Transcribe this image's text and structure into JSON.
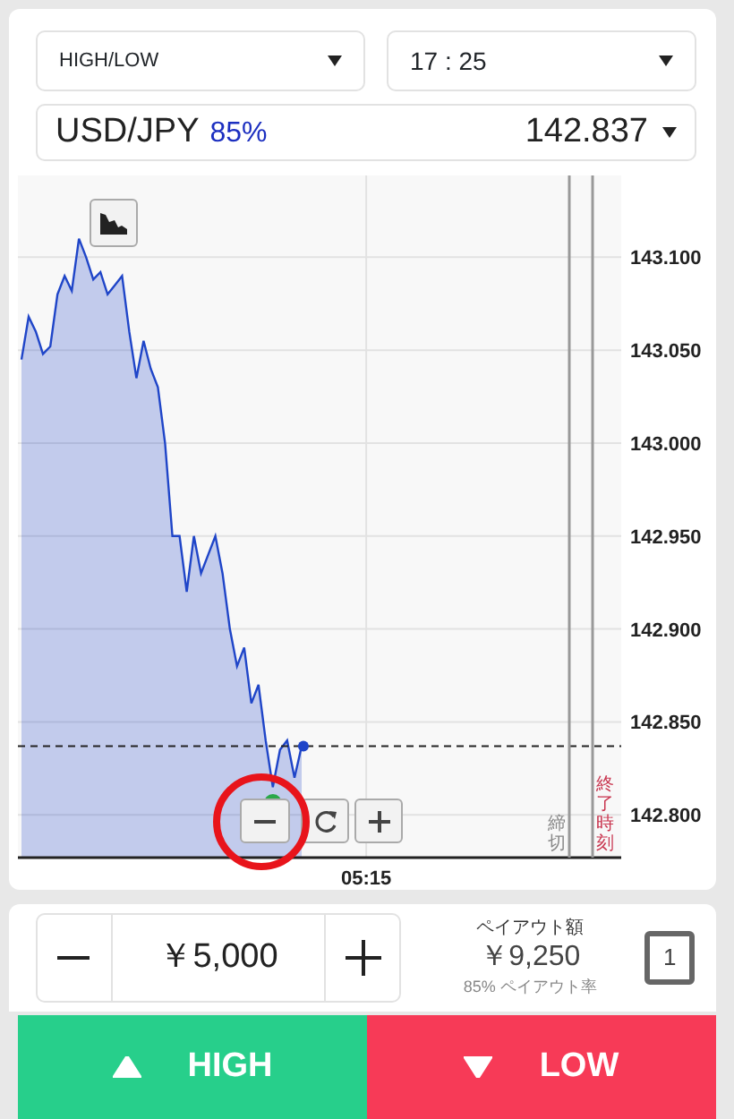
{
  "trade_type": {
    "value": "HIGH/LOW"
  },
  "expiry": {
    "value": "17 : 25"
  },
  "asset": {
    "name": "USD/JPY",
    "payout_rate": "85%",
    "price": "142.837"
  },
  "chart": {
    "deadline_label": "締切",
    "end_label": "終了時刻",
    "chart_data": {
      "type": "area",
      "categories": [
        null,
        null,
        null,
        null,
        null,
        null,
        null,
        null,
        null,
        null,
        null,
        null,
        null,
        null,
        null,
        null,
        null,
        null,
        null,
        null,
        null,
        null,
        null,
        null,
        null,
        null,
        null,
        null,
        null,
        null,
        null,
        null,
        null,
        null,
        null,
        null,
        null,
        null,
        null,
        null,
        null,
        null,
        null,
        null,
        null,
        null,
        null,
        null,
        "05:15",
        null,
        null,
        null,
        null,
        null,
        null,
        null,
        null,
        null,
        null,
        null,
        null,
        null,
        null,
        null,
        null,
        null,
        null,
        null,
        null,
        null,
        null,
        null,
        null,
        null,
        null,
        null,
        null,
        null,
        null,
        null,
        null,
        null,
        null,
        null
      ],
      "series": [
        {
          "color": "#1f45c8",
          "values": [
            143.045,
            143.068,
            143.06,
            143.048,
            143.052,
            143.08,
            143.09,
            143.082,
            143.11,
            143.1,
            143.088,
            143.092,
            143.08,
            143.085,
            143.09,
            143.06,
            143.035,
            143.055,
            143.04,
            143.03,
            143.0,
            142.95,
            142.95,
            142.92,
            142.95,
            142.93,
            142.94,
            142.95,
            142.93,
            142.9,
            142.88,
            142.89,
            142.86,
            142.87,
            142.84,
            142.815,
            142.835,
            142.84,
            142.82,
            142.837,
            null,
            null,
            null,
            null,
            null,
            null,
            null,
            null,
            null,
            null,
            null,
            null,
            null,
            null,
            null,
            null,
            null,
            null,
            null,
            null,
            null,
            null,
            null,
            null,
            null,
            null,
            null,
            null,
            null,
            null,
            null,
            null,
            null,
            null,
            null,
            null,
            null,
            null,
            null,
            null,
            null,
            null,
            null,
            null
          ]
        }
      ],
      "ylim": [
        142.777,
        143.144
      ],
      "yticks": [
        {
          "value": 142.8,
          "label": "142.800"
        },
        {
          "value": 142.85,
          "label": "142.850"
        },
        {
          "value": 142.9,
          "label": "142.900"
        },
        {
          "value": 142.95,
          "label": "142.950"
        },
        {
          "value": 143.0,
          "label": "143.000"
        },
        {
          "value": 143.05,
          "label": "143.050"
        },
        {
          "value": 143.1,
          "label": "143.100"
        }
      ],
      "grid": true,
      "ref_lines": [
        {
          "axis": "y",
          "value": 142.837
        }
      ]
    }
  },
  "amount": {
    "value": "￥5,000"
  },
  "payout": {
    "label": "ペイアウト額",
    "amount": "￥9,250",
    "rate": "85% ペイアウト率"
  },
  "position_count": "1",
  "buttons": [
    {
      "kind": "high",
      "label": "HIGH"
    },
    {
      "kind": "low",
      "label": "LOW"
    }
  ]
}
